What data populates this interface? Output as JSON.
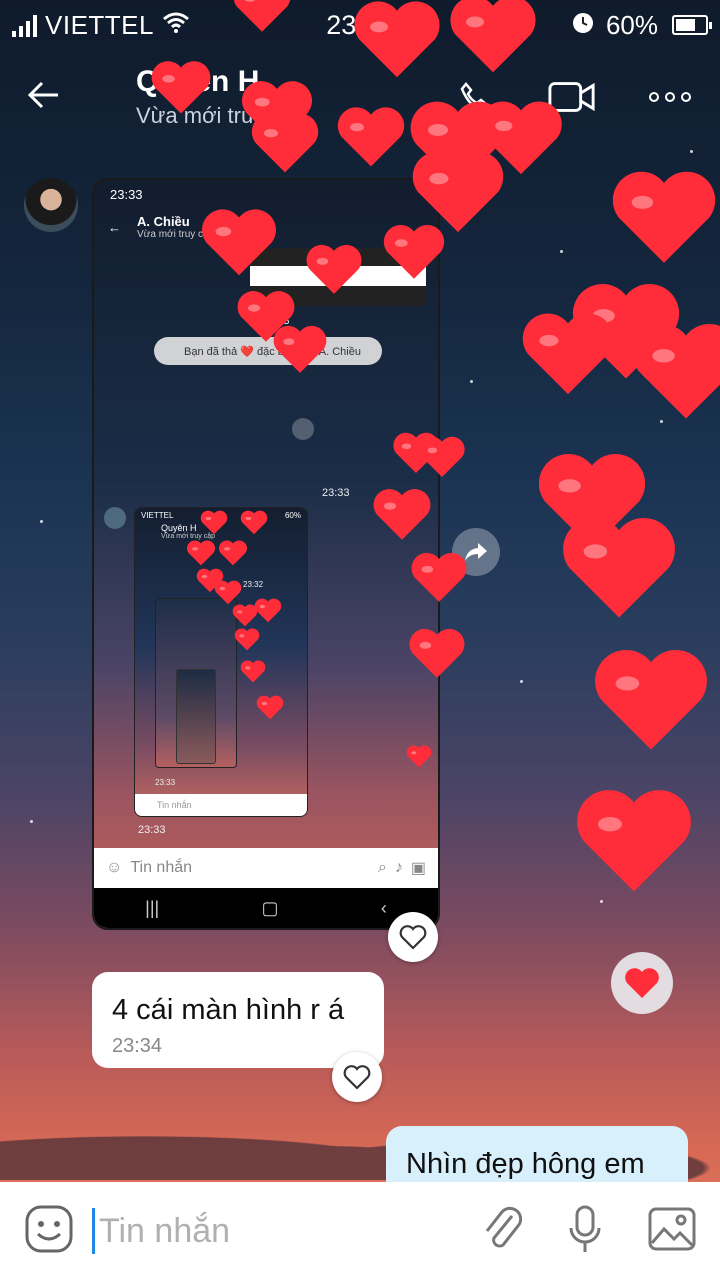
{
  "status_bar": {
    "carrier": "VIETTEL",
    "time": "23:35",
    "battery": "60%",
    "battery_level": 0.6
  },
  "header": {
    "contact_name": "Quyên H",
    "contact_status": "Vừa mới truy cập",
    "icons": [
      "back-arrow-icon",
      "phone-icon",
      "video-camera-icon",
      "more-dots-icon"
    ]
  },
  "messages": {
    "screenshot": {
      "status_time": "23:33",
      "contact_name": "A. Chiều",
      "contact_status": "Vừa mới truy cập",
      "reaction_pill": "Bạn đã thả ❤️ đặc biệt cho A. Chiều",
      "time_1": "23:33",
      "time_2": "23:33",
      "inner": {
        "carrier": "VIETTEL",
        "battery": "60%",
        "contact_name": "Quyên H",
        "contact_status": "Vừa mới truy cập",
        "time_1": "23:32",
        "input_placeholder": "Tin nhắn",
        "time_2": "23:33"
      },
      "input_placeholder": "Tin nhắn"
    },
    "incoming_text": {
      "text": "4 cái màn hình r á",
      "time": "23:34"
    },
    "outgoing_text": {
      "text": "Nhìn đẹp hông em"
    }
  },
  "input_bar": {
    "placeholder": "Tin nhắn",
    "icons": [
      "emoji-icon",
      "attachment-icon",
      "microphone-icon",
      "image-icon"
    ]
  },
  "colors": {
    "heart": "#ff2d3a",
    "outgoing_bubble": "#d8effc",
    "cursor": "#1e88e5"
  }
}
